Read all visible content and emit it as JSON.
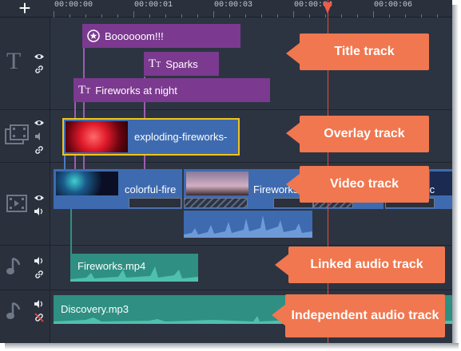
{
  "ruler": {
    "add_label": "+",
    "timecodes": [
      "00:00:00",
      "00:00:01",
      "00:00:03",
      "00:00:04",
      "00:00:06"
    ]
  },
  "tracks": {
    "titles": {
      "clips": [
        {
          "label": "Boooooom!!!",
          "icon": "star-badge-icon"
        },
        {
          "label": "Sparks",
          "icon": "text-tt-icon"
        },
        {
          "label": "Fireworks at night",
          "icon": "text-tt-icon"
        }
      ]
    },
    "overlay": {
      "clip_label": "exploding-fireworks-"
    },
    "video": {
      "clips": [
        "colorful-fire",
        "Fireworks.",
        ".c"
      ]
    },
    "linked_audio": {
      "clip_label": "Fireworks.mp4"
    },
    "independent_audio": {
      "clip_label": "Discovery.mp3"
    }
  },
  "callouts": {
    "title_track": "Title track",
    "overlay_track": "Overlay track",
    "video_track": "Video track",
    "linked_audio_track": "Linked audio track",
    "independent_audio_track": "Independent audio track"
  },
  "colors": {
    "timeline_bg": "#2d3441",
    "title_clip": "#7b3a8f",
    "video_clip": "#3e6bb0",
    "audio_clip": "#2f8f83",
    "playhead": "#e74c3c",
    "callout": "#f0774f",
    "selection": "#f0c419"
  }
}
